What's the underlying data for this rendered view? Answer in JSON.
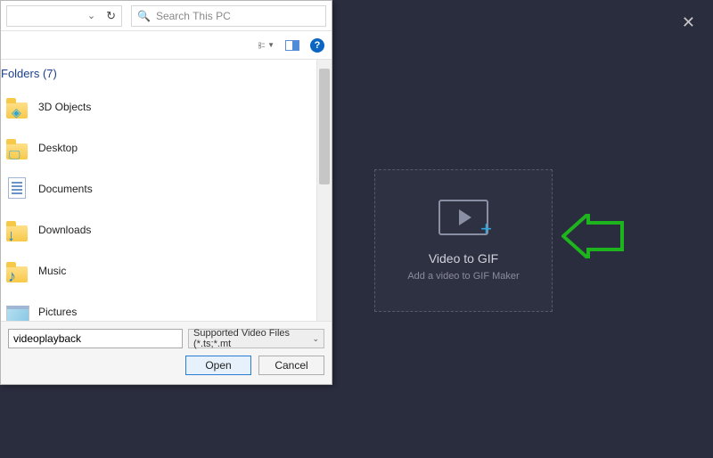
{
  "app": {
    "close_glyph": "✕",
    "dropzone": {
      "title": "Video to GIF",
      "subtitle": "Add a video to GIF Maker",
      "plus": "+"
    }
  },
  "dialog": {
    "search_placeholder": "Search This PC",
    "folders_header": "Folders (7)",
    "items": [
      {
        "label": "3D Objects",
        "icon": "3d"
      },
      {
        "label": "Desktop",
        "icon": "desktop"
      },
      {
        "label": "Documents",
        "icon": "documents"
      },
      {
        "label": "Downloads",
        "icon": "downloads"
      },
      {
        "label": "Music",
        "icon": "music"
      },
      {
        "label": "Pictures",
        "icon": "pictures"
      }
    ],
    "filename_value": "videoplayback",
    "filter_label": "Supported Video Files (*.ts;*.mt",
    "open_label": "Open",
    "cancel_label": "Cancel",
    "help_glyph": "?",
    "refresh_glyph": "↻",
    "dropdown_glyph": "⌄",
    "search_glyph": "🔍"
  }
}
